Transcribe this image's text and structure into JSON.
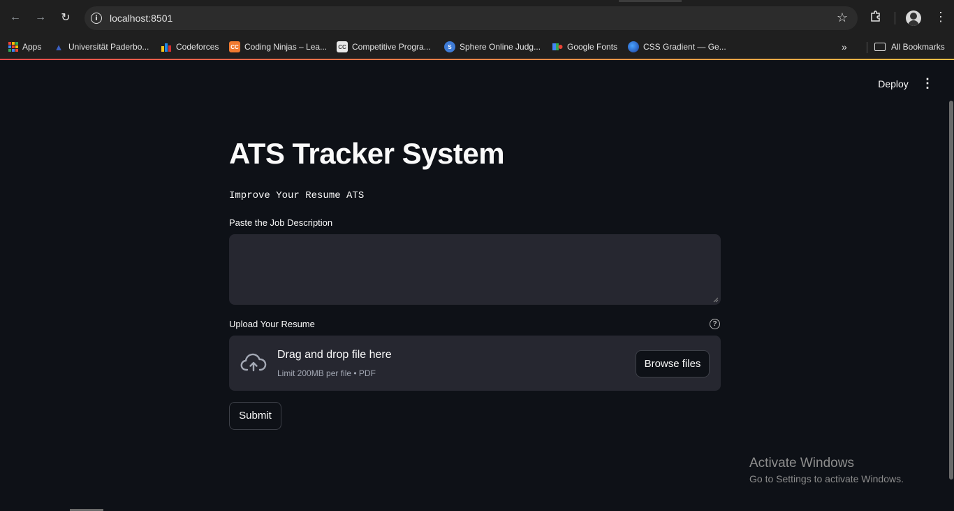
{
  "browser": {
    "url": "localhost:8501",
    "bookmarks": [
      {
        "label": "Apps",
        "icon": "apps-grid-icon"
      },
      {
        "label": "Universität Paderbo...",
        "icon": "university-icon"
      },
      {
        "label": "Codeforces",
        "icon": "codeforces-icon"
      },
      {
        "label": "Coding Ninjas – Lea...",
        "icon": "coding-ninjas-icon"
      },
      {
        "label": "Competitive Progra...",
        "icon": "competitive-programming-icon"
      },
      {
        "label": "Sphere Online Judg...",
        "icon": "spoj-icon"
      },
      {
        "label": "Google Fonts",
        "icon": "google-fonts-icon"
      },
      {
        "label": "CSS Gradient — Ge...",
        "icon": "css-gradient-icon"
      }
    ],
    "all_bookmarks": "All Bookmarks",
    "overflow": "»"
  },
  "app": {
    "deploy_label": "Deploy",
    "title": "ATS Tracker System",
    "subtitle": "Improve Your Resume ATS",
    "job_description_label": "Paste the Job Description",
    "job_description_value": "",
    "upload_label": "Upload Your Resume",
    "dropzone_title": "Drag and drop file here",
    "dropzone_limit": "Limit 200MB per file • PDF",
    "browse_label": "Browse files",
    "submit_label": "Submit",
    "accent_colors": [
      "#ff4b4b",
      "#ffbd45"
    ]
  },
  "os": {
    "watermark_title": "Activate Windows",
    "watermark_sub": "Go to Settings to activate Windows."
  }
}
